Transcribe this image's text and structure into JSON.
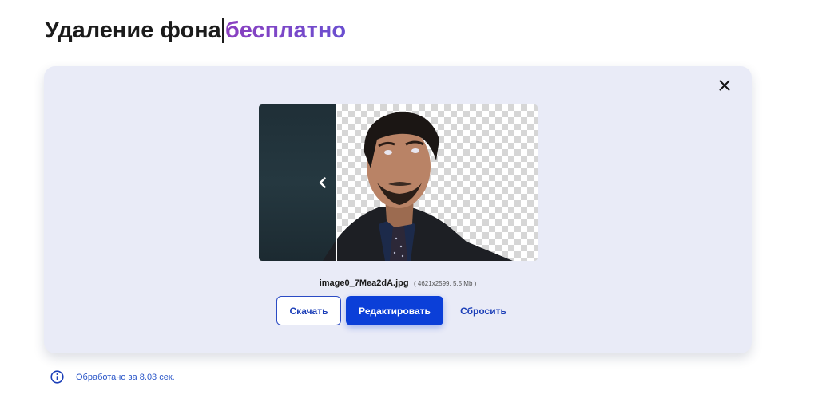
{
  "header": {
    "title_main": "Удаление фона",
    "title_accent": "бесплатно"
  },
  "editor": {
    "close_icon": "close-icon",
    "compare_handle_icon": "chevron-left-icon",
    "file": {
      "name": "image0_7Mea2dA.jpg",
      "meta": "( 4621x2599, 5.5 Mb )"
    },
    "actions": {
      "download_label": "Скачать",
      "edit_label": "Редактировать",
      "reset_label": "Сбросить"
    }
  },
  "status": {
    "icon": "info-icon",
    "text": "Обработано за 8.03 сек."
  },
  "colors": {
    "accent_purple": "#8b3fc0",
    "primary_blue": "#0b3fd8",
    "link_blue": "#1c3fb8",
    "card_bg": "#e9ebf7"
  }
}
